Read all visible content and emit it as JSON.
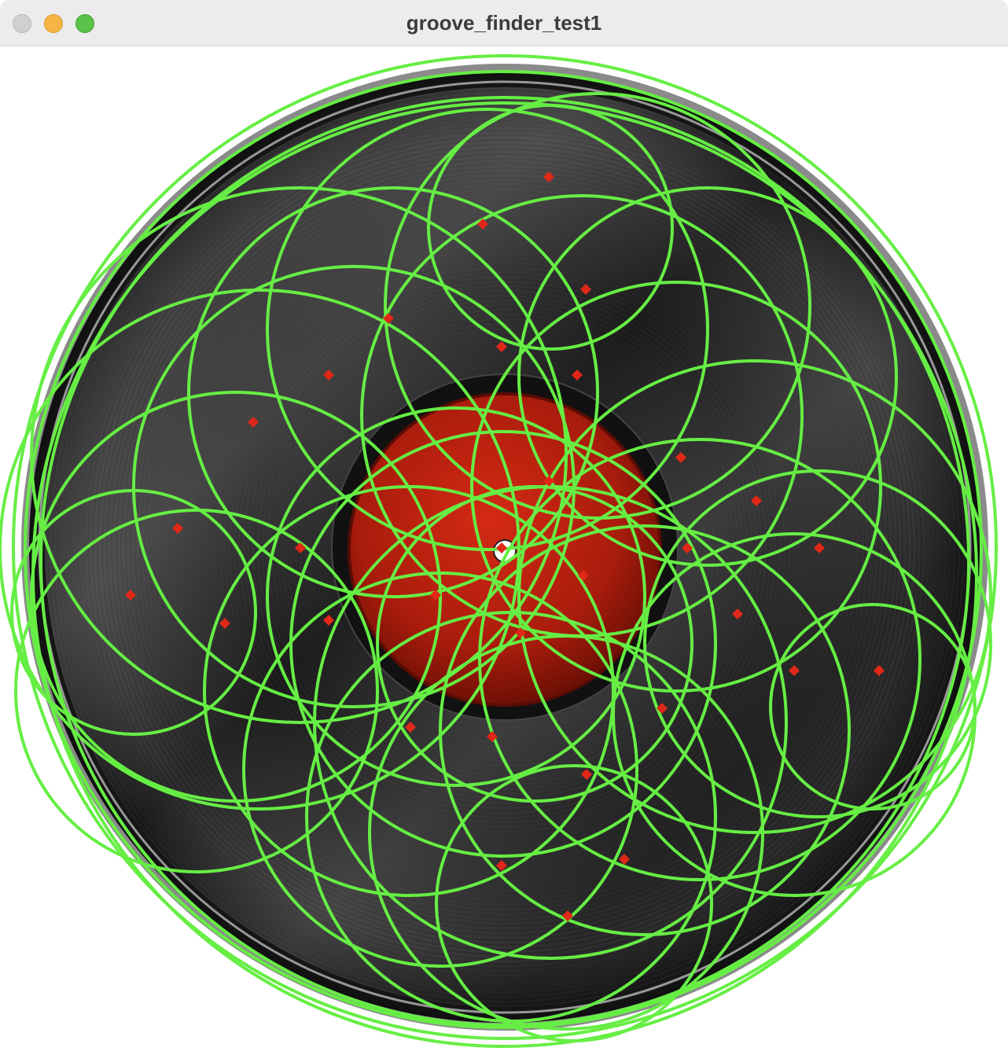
{
  "window": {
    "title": "groove_finder_test1",
    "controls": {
      "close_color": "#d0d0d0",
      "minimize_color": "#f5b545",
      "maximize_color": "#5bc24a"
    }
  },
  "canvas": {
    "record_label_color": "#b8200f",
    "vinyl_color": "#161616",
    "circle_color": "#66ee44",
    "marker_color": "#e02818",
    "background_color": "#ffffff"
  }
}
